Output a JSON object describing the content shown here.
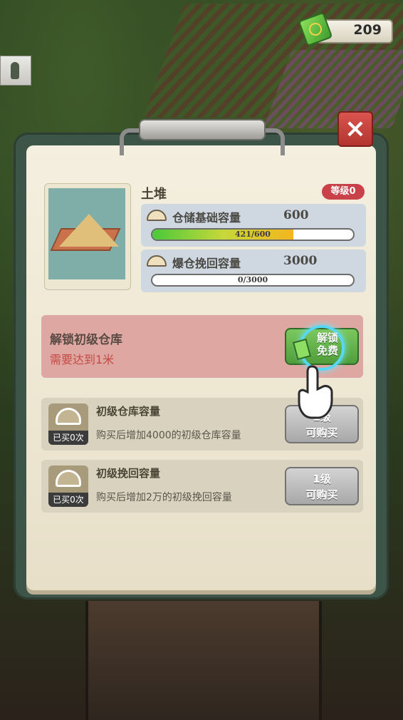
{
  "hud": {
    "money": "209"
  },
  "panel": {
    "close_icon": "×",
    "item_name": "土堆",
    "level_badge": "等级0",
    "stats": [
      {
        "label": "仓储基础容量",
        "value": "600",
        "bar_text": "421/600",
        "progress": 0.7017
      },
      {
        "label": "爆仓挽回容量",
        "value": "3000",
        "bar_text": "0/3000",
        "progress": 0
      }
    ],
    "unlock": {
      "title": "解锁初级仓库",
      "subtitle": "需要达到1米",
      "button_line1": "解锁",
      "button_line2": "免费"
    },
    "upgrades": [
      {
        "title": "初级仓库容量",
        "description": "购买后增加4000的初级仓库容量",
        "bought": "已买0次",
        "button_line1": "1级",
        "button_line2": "可购买"
      },
      {
        "title": "初级挽回容量",
        "description": "购买后增加2万的初级挽回容量",
        "bought": "已买0次",
        "button_line1": "1级",
        "button_line2": "可购买"
      }
    ]
  },
  "icons": {
    "money": "money-stack-icon",
    "hand": "tap-hand-icon",
    "sand": "sand-pile-icon"
  }
}
